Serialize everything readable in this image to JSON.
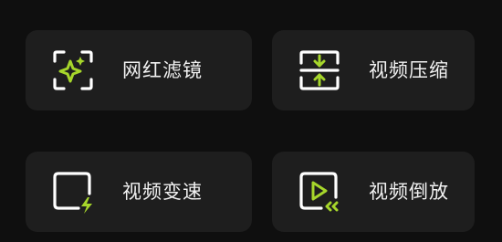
{
  "tools": {
    "filter": {
      "label": "网红滤镜",
      "icon": "sparkle-scan-icon"
    },
    "compress": {
      "label": "视频压缩",
      "icon": "compress-arrows-icon"
    },
    "speed": {
      "label": "视频变速",
      "icon": "lightning-speed-icon"
    },
    "reverse": {
      "label": "视频倒放",
      "icon": "play-rewind-icon"
    }
  },
  "colors": {
    "background": "#0f0f0f",
    "card": "#1e1e1e",
    "accent": "#a6d62b",
    "icon_line": "#ffffff",
    "text": "#f2f2f2"
  }
}
